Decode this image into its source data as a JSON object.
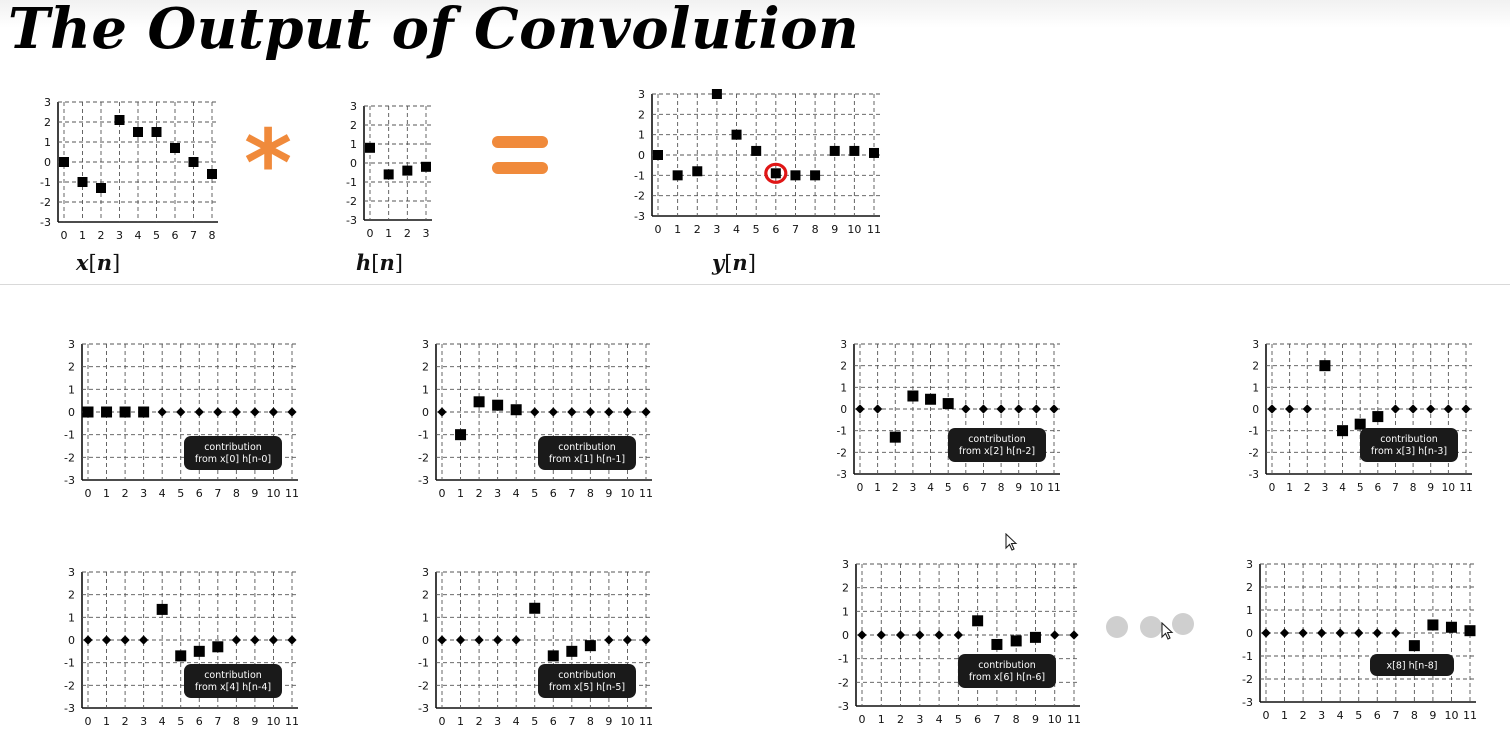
{
  "title": "The Output of Convolution",
  "operators": {
    "convolve": "*"
  },
  "ellipsis": [
    "•",
    "•",
    "•"
  ],
  "chart_data": [
    {
      "id": "x",
      "type": "scatter",
      "name_var": "x",
      "name_idx": "n",
      "x": [
        0,
        1,
        2,
        3,
        4,
        5,
        6,
        7,
        8
      ],
      "values": [
        0,
        -1,
        -1.3,
        2.1,
        1.5,
        1.5,
        0.7,
        0,
        -0.6
      ],
      "ylim": [
        -3,
        3
      ],
      "xticks": [
        "0",
        "1",
        "2",
        "3",
        "4",
        "5",
        "6",
        "7",
        "8"
      ],
      "yticks": [
        "3",
        "2",
        "1",
        "0",
        "-1",
        "-2",
        "-3"
      ],
      "grid": true
    },
    {
      "id": "h",
      "type": "scatter",
      "name_var": "h",
      "name_idx": "n",
      "x": [
        0,
        1,
        2,
        3
      ],
      "values": [
        0.8,
        -0.6,
        -0.4,
        -0.2
      ],
      "ylim": [
        -3,
        3
      ],
      "xticks": [
        "0",
        "1",
        "2",
        "3"
      ],
      "yticks": [
        "3",
        "2",
        "1",
        "0",
        "-1",
        "-2",
        "-3"
      ],
      "grid": true
    },
    {
      "id": "y",
      "type": "scatter",
      "name_var": "y",
      "name_idx": "n",
      "x": [
        0,
        1,
        2,
        3,
        4,
        5,
        6,
        7,
        8,
        9,
        10,
        11
      ],
      "values": [
        0,
        -1,
        -0.8,
        3,
        1,
        0.2,
        -0.9,
        -1,
        -1,
        0.2,
        0.2,
        0.1
      ],
      "highlight_x": 6,
      "ylim": [
        -3,
        3
      ],
      "xticks": [
        "0",
        "1",
        "2",
        "3",
        "4",
        "5",
        "6",
        "7",
        "8",
        "9",
        "10",
        "11"
      ],
      "yticks": [
        "3",
        "2",
        "1",
        "0",
        "-1",
        "-2",
        "-3"
      ],
      "grid": true
    },
    {
      "id": "c0",
      "type": "scatter",
      "x_start": 0,
      "values": [
        0,
        0,
        0,
        0,
        0,
        0,
        0,
        0,
        0,
        0,
        0,
        0
      ],
      "nonzero": [
        0,
        1,
        2,
        3
      ],
      "label": [
        "contribution",
        "from x[0] h[n-0]"
      ],
      "ylim": [
        -3,
        3
      ],
      "xticks": [
        "0",
        "1",
        "2",
        "3",
        "4",
        "5",
        "6",
        "7",
        "8",
        "9",
        "10",
        "11"
      ],
      "yticks": [
        "3",
        "2",
        "1",
        "0",
        "-1",
        "-2",
        "-3"
      ],
      "grid": true
    },
    {
      "id": "c1",
      "type": "scatter",
      "values": [
        0,
        -1,
        0.45,
        0.3,
        0.1,
        0,
        0,
        0,
        0,
        0,
        0,
        0
      ],
      "nonzero": [
        1,
        2,
        3,
        4
      ],
      "label": [
        "contribution",
        "from x[1] h[n-1]"
      ],
      "ylim": [
        -3,
        3
      ],
      "xticks": [
        "0",
        "1",
        "2",
        "3",
        "4",
        "5",
        "6",
        "7",
        "8",
        "9",
        "10",
        "11"
      ],
      "yticks": [
        "3",
        "2",
        "1",
        "0",
        "-1",
        "-2",
        "-3"
      ],
      "grid": true
    },
    {
      "id": "c2",
      "type": "scatter",
      "values": [
        0,
        0,
        -1.3,
        0.6,
        0.45,
        0.25,
        0,
        0,
        0,
        0,
        0,
        0
      ],
      "nonzero": [
        2,
        3,
        4,
        5
      ],
      "label": [
        "contribution",
        "from x[2] h[n-2]"
      ],
      "ylim": [
        -3,
        3
      ],
      "xticks": [
        "0",
        "1",
        "2",
        "3",
        "4",
        "5",
        "6",
        "7",
        "8",
        "9",
        "10",
        "11"
      ],
      "yticks": [
        "3",
        "2",
        "1",
        "0",
        "-1",
        "-2",
        "-3"
      ],
      "grid": true
    },
    {
      "id": "c3",
      "type": "scatter",
      "values": [
        0,
        0,
        0,
        2,
        -1,
        -0.7,
        -0.35,
        0,
        0,
        0,
        0,
        0
      ],
      "nonzero": [
        3,
        4,
        5,
        6
      ],
      "label": [
        "contribution",
        "from x[3] h[n-3]"
      ],
      "ylim": [
        -3,
        3
      ],
      "xticks": [
        "0",
        "1",
        "2",
        "3",
        "4",
        "5",
        "6",
        "7",
        "8",
        "9",
        "10",
        "11"
      ],
      "yticks": [
        "3",
        "2",
        "1",
        "0",
        "-1",
        "-2",
        "-3"
      ],
      "grid": true
    },
    {
      "id": "c4",
      "type": "scatter",
      "values": [
        0,
        0,
        0,
        0,
        1.35,
        -0.7,
        -0.5,
        -0.3,
        0,
        0,
        0,
        0
      ],
      "nonzero": [
        4,
        5,
        6,
        7
      ],
      "label": [
        "contribution",
        "from x[4] h[n-4]"
      ],
      "ylim": [
        -3,
        3
      ],
      "xticks": [
        "0",
        "1",
        "2",
        "3",
        "4",
        "5",
        "6",
        "7",
        "8",
        "9",
        "10",
        "11"
      ],
      "yticks": [
        "3",
        "2",
        "1",
        "0",
        "-1",
        "-2",
        "-3"
      ],
      "grid": true
    },
    {
      "id": "c5",
      "type": "scatter",
      "values": [
        0,
        0,
        0,
        0,
        0,
        1.4,
        -0.7,
        -0.5,
        -0.25,
        0,
        0,
        0
      ],
      "nonzero": [
        5,
        6,
        7,
        8
      ],
      "label": [
        "contribution",
        "from x[5] h[n-5]"
      ],
      "ylim": [
        -3,
        3
      ],
      "xticks": [
        "0",
        "1",
        "2",
        "3",
        "4",
        "5",
        "6",
        "7",
        "8",
        "9",
        "10",
        "11"
      ],
      "yticks": [
        "3",
        "2",
        "1",
        "0",
        "-1",
        "-2",
        "-3"
      ],
      "grid": true
    },
    {
      "id": "c6",
      "type": "scatter",
      "values": [
        0,
        0,
        0,
        0,
        0,
        0,
        0.6,
        -0.4,
        -0.25,
        -0.1,
        0,
        0
      ],
      "nonzero": [
        6,
        7,
        8,
        9
      ],
      "label": [
        "contribution",
        "from x[6] h[n-6]"
      ],
      "ylim": [
        -3,
        3
      ],
      "xticks": [
        "0",
        "1",
        "2",
        "3",
        "4",
        "5",
        "6",
        "7",
        "8",
        "9",
        "10",
        "11"
      ],
      "yticks": [
        "3",
        "2",
        "1",
        "0",
        "-1",
        "-2",
        "-3"
      ],
      "grid": true
    },
    {
      "id": "c8",
      "type": "scatter",
      "values": [
        0,
        0,
        0,
        0,
        0,
        0,
        0,
        0,
        -0.55,
        0.35,
        0.25,
        0.1
      ],
      "nonzero": [
        8,
        9,
        10,
        11
      ],
      "label": [
        "x[8] h[n-8]"
      ],
      "ylim": [
        -3,
        3
      ],
      "xticks": [
        "0",
        "1",
        "2",
        "3",
        "4",
        "5",
        "6",
        "7",
        "8",
        "9",
        "10",
        "11"
      ],
      "yticks": [
        "3",
        "2",
        "1",
        "0",
        "-1",
        "-2",
        "-3"
      ],
      "grid": true
    }
  ]
}
